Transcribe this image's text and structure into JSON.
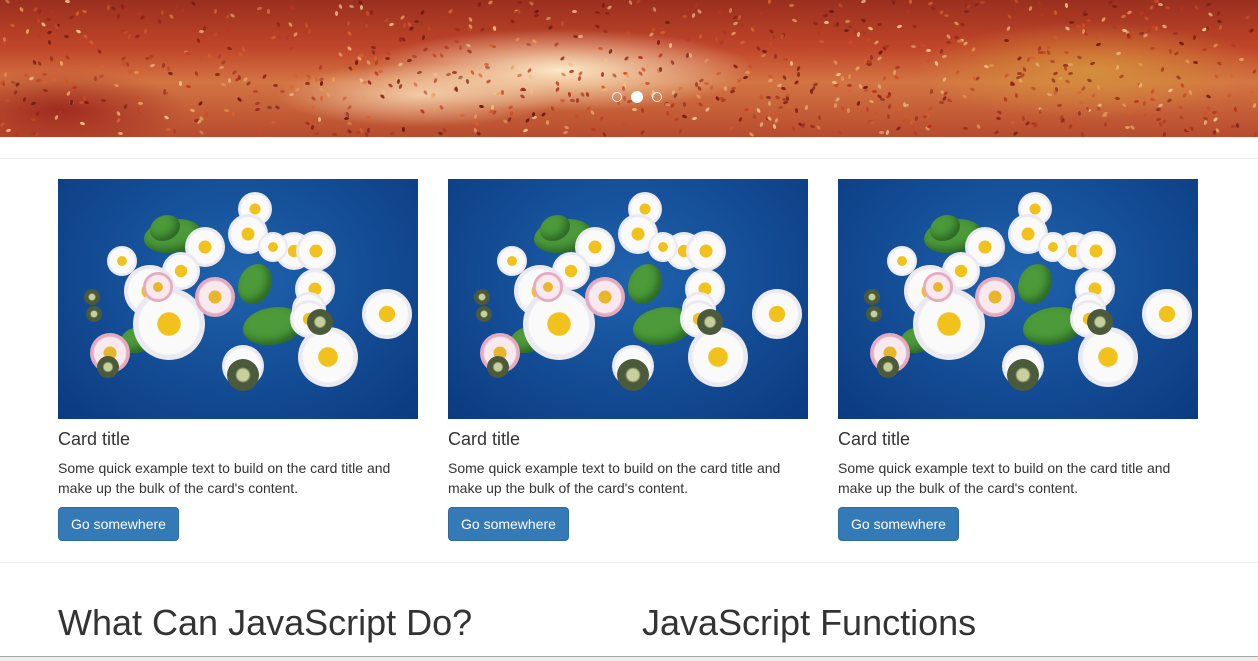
{
  "hero": {
    "indicators": [
      {
        "active": false
      },
      {
        "active": true
      },
      {
        "active": false
      }
    ]
  },
  "cards": [
    {
      "title": "Card title",
      "text": "Some quick example text to build on the card title and make up the bulk of the card's content.",
      "button_label": "Go somewhere"
    },
    {
      "title": "Card title",
      "text": "Some quick example text to build on the card title and make up the bulk of the card's content.",
      "button_label": "Go somewhere"
    },
    {
      "title": "Card title",
      "text": "Some quick example text to build on the card title and make up the bulk of the card's content.",
      "button_label": "Go somewhere"
    }
  ],
  "sections": {
    "left_heading": "What Can JavaScript Do?",
    "right_heading": "JavaScript Functions"
  },
  "colors": {
    "button_bg": "#337ab7",
    "button_border": "#2e6da4",
    "text": "#333333"
  }
}
